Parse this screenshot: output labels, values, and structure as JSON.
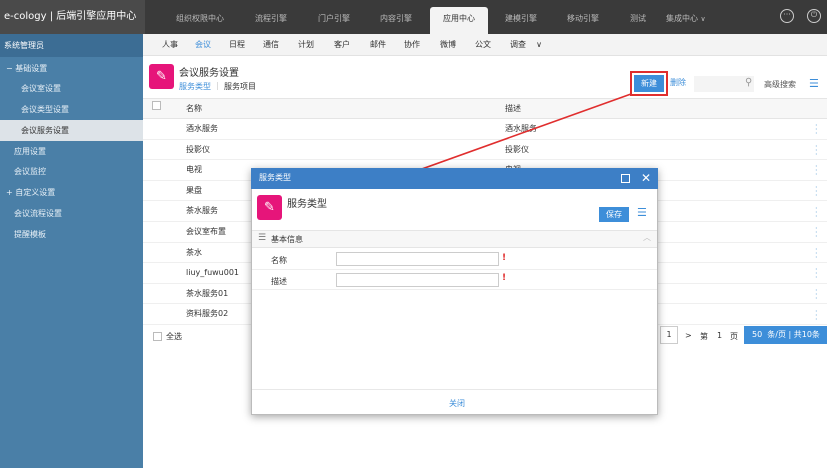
{
  "header": {
    "brand": "e-cology | 后端引擎应用中心",
    "nav": [
      "组织权限中心",
      "流程引擎",
      "门户引擎",
      "内容引擎",
      "应用中心",
      "建模引擎",
      "移动引擎",
      "测试",
      "集成中心"
    ],
    "nav_caret": "∨",
    "icons": [
      "more-icon",
      "power-icon"
    ]
  },
  "sidebar": {
    "title": "系统管理员",
    "items": [
      {
        "label": "基础设置",
        "prefix": "−",
        "level": 0
      },
      {
        "label": "会议室设置",
        "level": 1
      },
      {
        "label": "会议类型设置",
        "level": 1
      },
      {
        "label": "会议服务设置",
        "level": 1,
        "active": true
      },
      {
        "label": "应用设置",
        "level": 0
      },
      {
        "label": "会议监控",
        "level": 0
      },
      {
        "label": "自定义设置",
        "prefix": "+",
        "level": 0
      },
      {
        "label": "会议流程设置",
        "level": 0
      },
      {
        "label": "提醒模板",
        "level": 0
      }
    ]
  },
  "subnav": {
    "items": [
      "人事",
      "会议",
      "日程",
      "通信",
      "计划",
      "客户",
      "邮件",
      "协作",
      "微博",
      "公文",
      "调查"
    ],
    "more": "∨"
  },
  "page": {
    "title": "会议服务设置",
    "tabs": [
      "服务类型",
      "服务项目"
    ],
    "tab_sep": "|",
    "new_label": "新建",
    "delete_label": "删除",
    "adv_search": "高级搜索"
  },
  "table": {
    "headers": [
      "名称",
      "描述"
    ],
    "rows": [
      [
        "酒水服务",
        "酒水服务"
      ],
      [
        "投影仪",
        "投影仪"
      ],
      [
        "电视",
        "电视"
      ],
      [
        "果盘",
        ""
      ],
      [
        "茶水服务",
        ""
      ],
      [
        "会议室布置",
        ""
      ],
      [
        "茶水",
        ""
      ],
      [
        "liuy_fuwu001",
        ""
      ],
      [
        "茶水服务01",
        ""
      ],
      [
        "资料服务02",
        ""
      ]
    ]
  },
  "footer": {
    "select_all": "全选",
    "current_page": "1",
    "next": ">",
    "page_prefix": "第",
    "page_num": "1",
    "page_suffix": "页",
    "page_size": "50",
    "page_size_suffix": "条/页 | 共10条"
  },
  "modal": {
    "title": "服务类型",
    "heading": "服务类型",
    "save_label": "保存",
    "section_label": "基本信息",
    "section_collapse": "︿",
    "fields": [
      {
        "label": "名称",
        "value": "",
        "required": "!"
      },
      {
        "label": "描述",
        "value": "",
        "required": "!"
      }
    ],
    "close_label": "关闭"
  },
  "colors": {
    "accent": "#3d8ed9",
    "brand_pink": "#e6157a",
    "highlight_red": "#e02e2e",
    "sidebar": "#4a7fa7"
  }
}
